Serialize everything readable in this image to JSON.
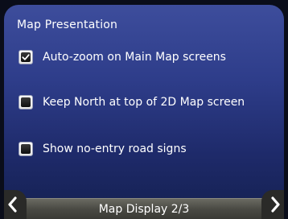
{
  "section": {
    "title": "Map Presentation"
  },
  "options": [
    {
      "label": "Auto-zoom on Main Map screens",
      "checked": true
    },
    {
      "label": "Keep North at top of 2D Map screen",
      "checked": false
    },
    {
      "label": "Show no-entry road signs",
      "checked": false
    }
  ],
  "footer": {
    "page_label": "Map Display 2/3"
  },
  "icons": {
    "prev": "chevron-left-icon",
    "next": "chevron-right-icon",
    "check": "checkmark-icon"
  },
  "colors": {
    "background_top": "#3d4d9c",
    "background_bottom": "#14204f",
    "bar": "#4a4a44"
  }
}
